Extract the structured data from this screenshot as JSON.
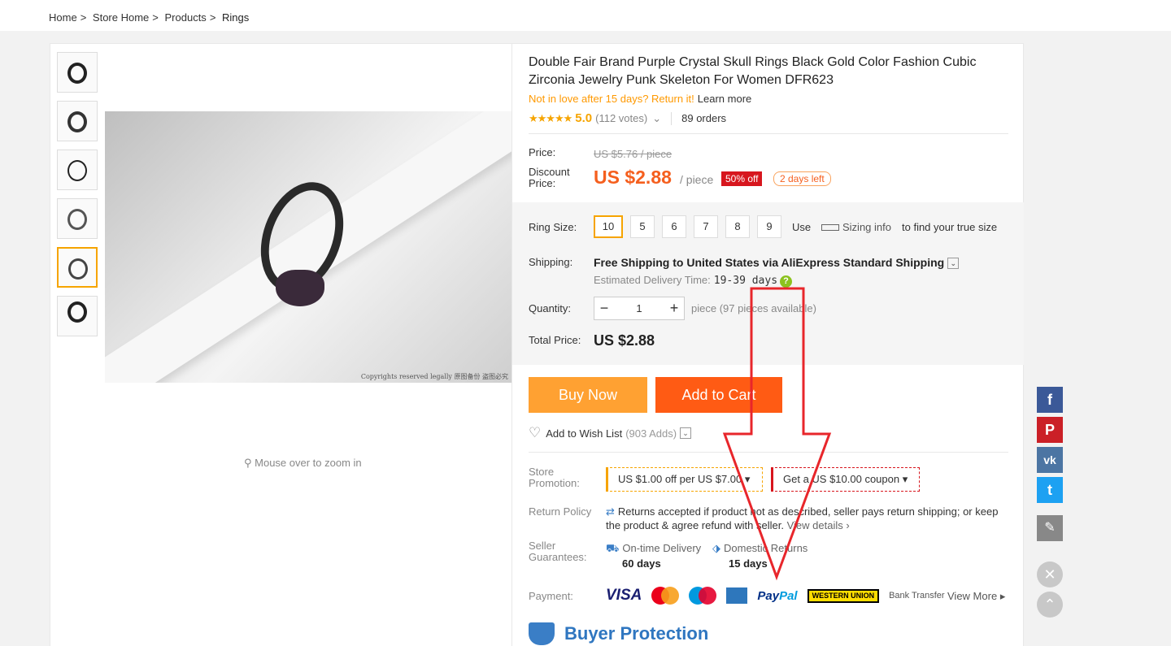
{
  "breadcrumb": {
    "home": "Home",
    "sep": ">",
    "store": "Store Home",
    "products": "Products",
    "current": "Rings"
  },
  "gallery": {
    "zoom_hint": "Mouse over to zoom in",
    "copyright": "Copyrights reserved legally 原图备份 盗图必究",
    "thumb_count": 6,
    "active_thumb": 5
  },
  "product": {
    "title": "Double Fair Brand Purple Crystal Skull Rings Black Gold Color Fashion Cubic Zirconia Jewelry Punk Skeleton For Women DFR623",
    "return_promo": "Not in love after 15 days? Return it!",
    "learn_more": "Learn more",
    "stars": "★★★★★",
    "rating": "5.0",
    "votes": "(112 votes)",
    "orders": "89 orders"
  },
  "price": {
    "label": "Price:",
    "old": "US $5.76 / piece",
    "discount_label": "Discount Price:",
    "current": "US $2.88",
    "unit": "/ piece",
    "off_badge": "50% off",
    "time_left": "2 days left"
  },
  "options": {
    "ring_size_label": "Ring Size:",
    "sizes": [
      "10",
      "5",
      "6",
      "7",
      "8",
      "9"
    ],
    "selected_size": "10",
    "use": "Use",
    "sizing_info": "Sizing info",
    "true_size": "to find your true size",
    "shipping_label": "Shipping:",
    "shipping_text": "Free Shipping to United States via AliExpress Standard Shipping",
    "est_label": "Estimated Delivery Time:",
    "est_days": "19-39 days",
    "qty_label": "Quantity:",
    "qty_value": "1",
    "qty_avail": "piece (97 pieces available)",
    "total_label": "Total Price:",
    "total": "US $2.88"
  },
  "actions": {
    "buy_now": "Buy Now",
    "add_cart": "Add to Cart",
    "wish": "Add to Wish List",
    "wish_count": "(903 Adds)"
  },
  "store": {
    "promo_label": "Store Promotion:",
    "coupon1": "US $1.00 off per US $7.00",
    "coupon2": "Get a US $10.00 coupon",
    "return_label": "Return Policy",
    "return_text": "Returns accepted if product not as described, seller pays return shipping; or keep the product & agree refund with seller.",
    "view_details": "View details",
    "guar_label": "Seller Guarantees:",
    "guar1_title": "On-time Delivery",
    "guar1_value": "60 days",
    "guar2_title": "Domestic Returns",
    "guar2_value": "15 days",
    "payment_label": "Payment:",
    "visa": "VISA",
    "paypal_a": "Pay",
    "paypal_b": "Pal",
    "wu": "WESTERN UNION",
    "bank": "Bank Transfer",
    "view_more": "View More",
    "buyer_protection": "Buyer Protection"
  },
  "social": {
    "facebook": "f",
    "pinterest": "P",
    "vk": "vk",
    "twitter": "t",
    "close": "✕",
    "up": "⌃"
  },
  "colors": {
    "accent": "#f55f1e",
    "buy": "#ffa132",
    "cart": "#ff5b14",
    "annotation_arrow": "#e8262b"
  }
}
